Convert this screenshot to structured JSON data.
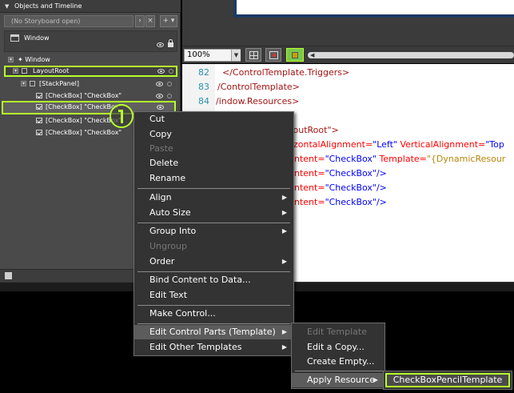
{
  "panel": {
    "title": "Objects and Timeline",
    "storyboard_placeholder": "(No Storyboard open)",
    "scope_label": "Window",
    "tree": [
      {
        "label": "Window"
      },
      {
        "label": "LayoutRoot"
      },
      {
        "label": "[StackPanel]"
      },
      {
        "label": "[CheckBox] \"CheckBox\""
      },
      {
        "label": "[CheckBox] \"CheckBox\""
      },
      {
        "label": "[CheckBox] \"CheckBox\""
      },
      {
        "label": "[CheckBox] \"CheckBox\""
      }
    ]
  },
  "toolbar": {
    "zoom": "100%"
  },
  "editor": {
    "line_numbers": [
      "82",
      "83",
      "84"
    ],
    "lines": [
      {
        "a": "</ControlTemplate.Triggers>"
      },
      {
        "a": "/ControlTemplate>"
      },
      {
        "a": "/indow.Resources>"
      },
      {
        "a": "youtRoot\">"
      },
      {
        "a": "zontalAlignment=",
        "b": "\"Left\"",
        "c": " VerticalAlignment=",
        "d": "\"Top"
      },
      {
        "a": "ntent=",
        "b": "\"CheckBox\"",
        "c": " Template=",
        "d": "\"{DynamicResour"
      },
      {
        "a": "ntent=",
        "b": "\"CheckBox\"",
        "c": "/>"
      },
      {
        "a": "ntent=",
        "b": "\"CheckBox\"",
        "c": "/>"
      },
      {
        "a": "ntent=",
        "b": "\"CheckBox\"",
        "c": "/>"
      }
    ]
  },
  "context_menu": {
    "items": [
      {
        "label": "Cut",
        "disabled": false
      },
      {
        "label": "Copy",
        "disabled": false
      },
      {
        "label": "Paste",
        "disabled": true
      },
      {
        "label": "Delete",
        "disabled": false
      },
      {
        "label": "Rename",
        "disabled": false
      },
      {
        "label": "Align",
        "disabled": false
      },
      {
        "label": "Auto Size",
        "disabled": false
      },
      {
        "label": "Group Into",
        "disabled": false
      },
      {
        "label": "Ungroup",
        "disabled": true
      },
      {
        "label": "Order",
        "disabled": false
      },
      {
        "label": "Bind Content to Data...",
        "disabled": false
      },
      {
        "label": "Edit Text",
        "disabled": false
      },
      {
        "label": "Make Control...",
        "disabled": false
      },
      {
        "label": "Edit Control Parts (Template)",
        "disabled": false
      },
      {
        "label": "Edit Other Templates",
        "disabled": false
      }
    ]
  },
  "control_parts_menu": {
    "items": [
      {
        "label": "Edit Template",
        "disabled": true
      },
      {
        "label": "Edit a Copy...",
        "disabled": false
      },
      {
        "label": "Create Empty...",
        "disabled": false
      },
      {
        "label": "Apply Resource",
        "disabled": false
      }
    ]
  },
  "apply_resource_menu": {
    "items": [
      {
        "label": "CheckBoxPencilTemplate"
      }
    ]
  },
  "colors": {
    "highlight": "#b6ff2b",
    "panel_bg": "#4a4a4a",
    "menu_bg": "#333333"
  }
}
